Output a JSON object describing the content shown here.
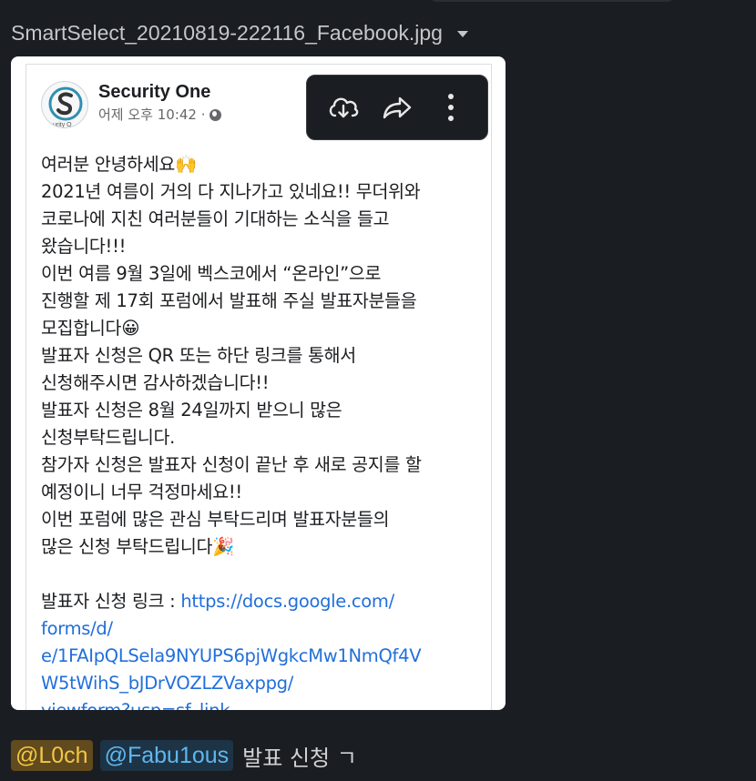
{
  "file": {
    "name": "SmartSelect_20210819-222116_Facebook.jpg",
    "dropdown_icon": "caret-down-icon"
  },
  "post": {
    "author": "Security One",
    "timestamp": "어제 오후 10:42 · ",
    "privacy_icon": "globe-icon",
    "lines": [
      "여러분 안녕하세요🙌",
      "2021년 여름이 거의 다 지나가고 있네요!! 무더위와",
      "코로나에 지친 여러분들이 기대하는 소식을 들고",
      "왔습니다!!!",
      "이번 여름 9월 3일에 벡스코에서 “온라인”으로",
      "진행할 제 17회 포럼에서 발표해 주실 발표자분들을",
      "모집합니다😀",
      "발표자 신청은 QR 또는 하단 링크를 통해서",
      "신청해주시면 감사하겠습니다!!",
      "발표자 신청은 8월 24일까지 받으니 많은",
      "신청부탁드립니다.",
      "참가자 신청은 발표자 신청이 끝난 후 새로 공지를 할",
      "예정이니 너무 걱정마세요!!",
      "이번 포럼에 많은 관심 부탁드리며 발표자분들의",
      "많은 신청 부탁드립니다🎉"
    ],
    "link_label": "발표자 신청 링크 : ",
    "link_lines": [
      "https://docs.google.com/",
      "forms/d/",
      "e/1FAIpQLSela9NYUPS6pjWgkcMw1NmQf4V",
      "W5tWihS_bJDrVOZLZVaxppg/",
      "viewform?usp=sf_link"
    ]
  },
  "toolbar": {
    "download_icon": "cloud-download-icon",
    "share_icon": "share-arrow-icon",
    "more_icon": "more-vertical-icon"
  },
  "message": {
    "mention_self": "@L0ch",
    "mention_other": "@Fabu1ous",
    "text": "발표 신청 ㄱ"
  },
  "colors": {
    "background": "#1a1d21",
    "mention_self_bg": "#614a1d",
    "mention_self_fg": "#f2c744",
    "mention_other_bg": "#1d3446",
    "mention_other_fg": "#5fb7f0",
    "link": "#216fdb"
  }
}
